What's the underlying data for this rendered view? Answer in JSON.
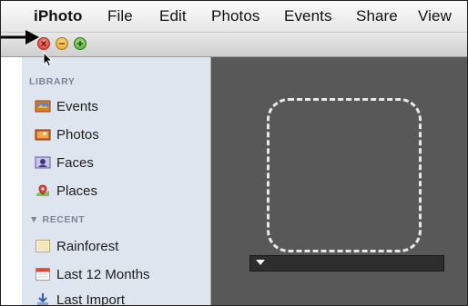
{
  "menubar": {
    "app": "iPhoto",
    "items": [
      "File",
      "Edit",
      "Photos",
      "Events",
      "Share",
      "View"
    ]
  },
  "window": {
    "buttons": [
      "close",
      "minimize",
      "zoom"
    ]
  },
  "sidebar": {
    "library_header": "LIBRARY",
    "library_items": [
      {
        "label": "Events",
        "icon": "events-icon"
      },
      {
        "label": "Photos",
        "icon": "photos-icon"
      },
      {
        "label": "Faces",
        "icon": "faces-icon"
      },
      {
        "label": "Places",
        "icon": "places-icon"
      }
    ],
    "recent_header": "▼ RECENT",
    "recent_items": [
      {
        "label": "Rainforest",
        "icon": "album-icon"
      },
      {
        "label": "Last 12 Months",
        "icon": "calendar-icon"
      },
      {
        "label": "Last Import",
        "icon": "import-icon"
      }
    ]
  },
  "colors": {
    "annotation": "#000000",
    "sidebar_bg": "#dfe5ee",
    "content_bg": "#585858"
  }
}
